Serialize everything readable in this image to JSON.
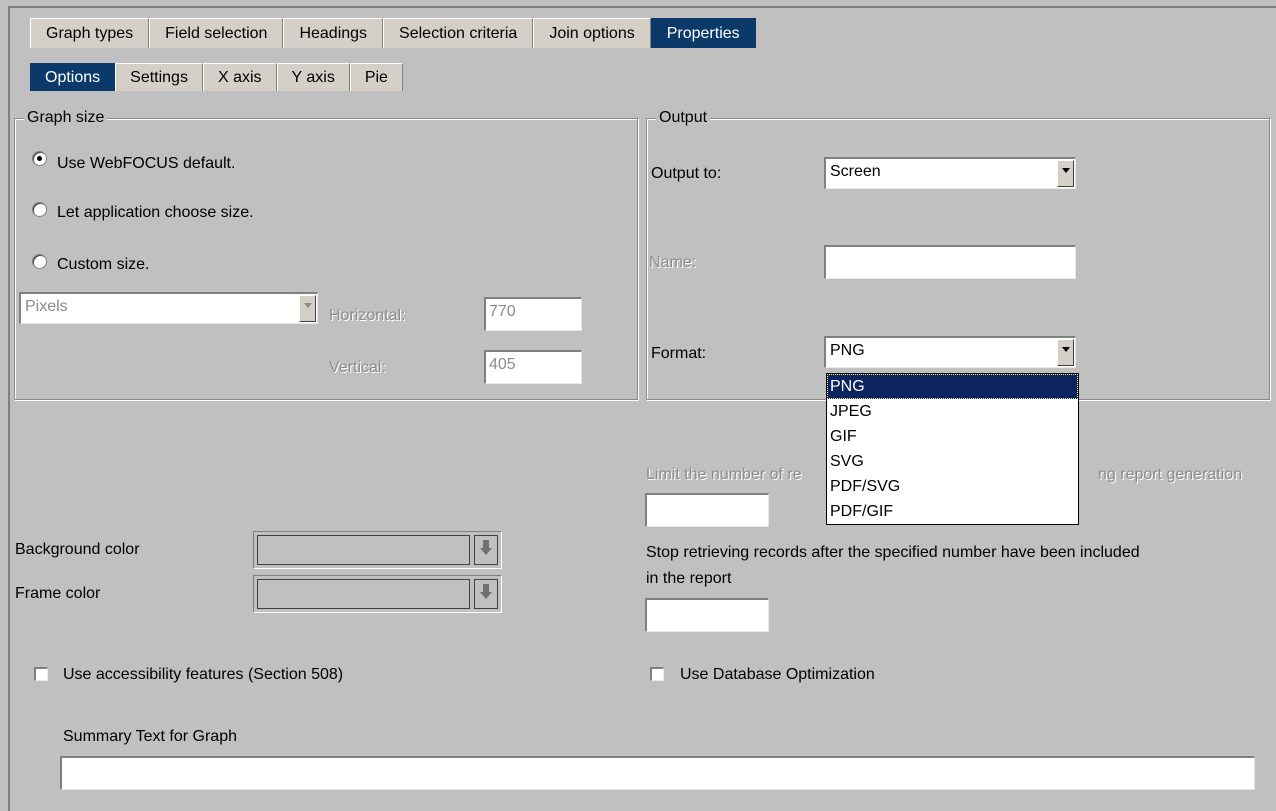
{
  "tabs": [
    "Graph types",
    "Field selection",
    "Headings",
    "Selection criteria",
    "Join options",
    "Properties"
  ],
  "subtabs": [
    "Options",
    "Settings",
    "X axis",
    "Y axis",
    "Pie"
  ],
  "graph_size": {
    "legend": "Graph size",
    "radio_default": "Use WebFOCUS default.",
    "radio_app": "Let application choose size.",
    "radio_custom": "Custom size.",
    "units_value": "Pixels",
    "horizontal_label": "Horizontal:",
    "horizontal_value": "770",
    "vertical_label": "Vertical:",
    "vertical_value": "405",
    "selected": "Use WebFOCUS default."
  },
  "output": {
    "legend": "Output",
    "output_to_label": "Output to:",
    "output_to_value": "Screen",
    "name_label": "Name:",
    "name_value": "",
    "format_label": "Format:",
    "format_value": "PNG",
    "format_options": [
      "PNG",
      "JPEG",
      "GIF",
      "SVG",
      "PDF/SVG",
      "PDF/GIF"
    ]
  },
  "limit": {
    "label_left": "Limit the number of re",
    "label_right": "ng report generation",
    "value": ""
  },
  "stop": {
    "label_line1": "Stop retrieving records after the specified number have been included",
    "label_line2": "in the report",
    "value": ""
  },
  "colors": {
    "background_label": "Background color",
    "frame_label": "Frame color",
    "accent": "#0b3a6a",
    "panel": "#c0c0c0"
  },
  "accessibility_label": "Use accessibility features (Section 508)",
  "db_optimization_label": "Use Database Optimization",
  "summary": {
    "label": "Summary Text for Graph",
    "value": ""
  }
}
